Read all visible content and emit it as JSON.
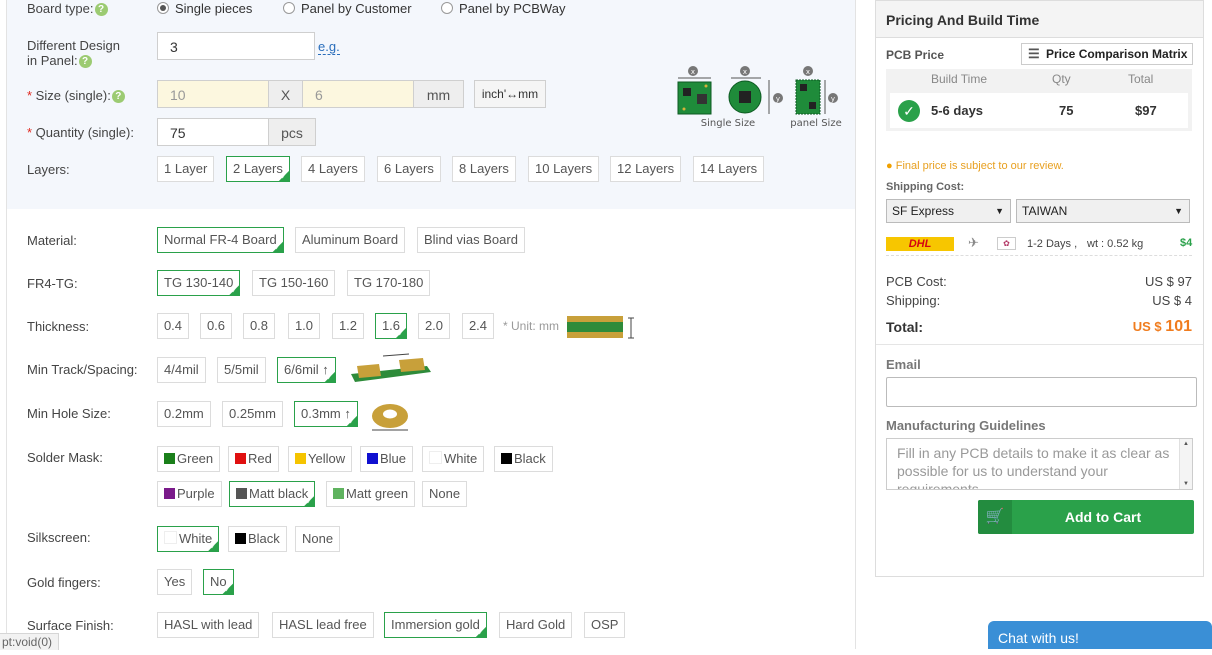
{
  "board_type": {
    "label": "Board type:",
    "options": [
      "Single pieces",
      "Panel by Customer",
      "Panel by PCBWay"
    ],
    "selected": 0
  },
  "diff_design": {
    "label_line1": "Different Design",
    "label_line2": "in Panel:",
    "value": "3",
    "link": "e.g."
  },
  "size": {
    "label": "Size (single):",
    "x_placeholder": "10",
    "sep": "X",
    "y_placeholder": "6",
    "unit": "mm",
    "toggle": "inch'↔mm"
  },
  "quantity": {
    "label": "Quantity (single):",
    "value": "75",
    "unit": "pcs"
  },
  "size_diagram": {
    "single": "Single Size",
    "panel": "panel Size",
    "x": "X",
    "y": "Y"
  },
  "layers": {
    "label": "Layers:",
    "options": [
      "1 Layer",
      "2 Layers",
      "4 Layers",
      "6 Layers",
      "8 Layers",
      "10 Layers",
      "12 Layers",
      "14 Layers"
    ],
    "selected": 1
  },
  "material": {
    "label": "Material:",
    "options": [
      "Normal FR-4 Board",
      "Aluminum Board",
      "Blind vias Board"
    ],
    "selected": 0
  },
  "fr4tg": {
    "label": "FR4-TG:",
    "options": [
      "TG 130-140",
      "TG 150-160",
      "TG 170-180"
    ],
    "selected": 0
  },
  "thickness": {
    "label": "Thickness:",
    "options": [
      "0.4",
      "0.6",
      "0.8",
      "1.0",
      "1.2",
      "1.6",
      "2.0",
      "2.4"
    ],
    "selected": 5,
    "unit": "* Unit: mm"
  },
  "track": {
    "label": "Min Track/Spacing:",
    "options": [
      "4/4mil",
      "5/5mil",
      "6/6mil ↑"
    ],
    "selected": 2
  },
  "hole": {
    "label": "Min Hole Size:",
    "options": [
      "0.2mm",
      "0.25mm",
      "0.3mm ↑"
    ],
    "selected": 2
  },
  "solder": {
    "label": "Solder Mask:",
    "options": [
      {
        "name": "Green",
        "color": "#1a7f1a"
      },
      {
        "name": "Red",
        "color": "#e01010"
      },
      {
        "name": "Yellow",
        "color": "#f5c400"
      },
      {
        "name": "Blue",
        "color": "#1010d0"
      },
      {
        "name": "White",
        "color": "#ffffff"
      },
      {
        "name": "Black",
        "color": "#000000"
      },
      {
        "name": "Purple",
        "color": "#7a1a8a"
      },
      {
        "name": "Matt black",
        "color": "#555555"
      },
      {
        "name": "Matt green",
        "color": "#5fb35f"
      },
      {
        "name": "None",
        "color": ""
      }
    ],
    "selected": 7
  },
  "silkscreen": {
    "label": "Silkscreen:",
    "options": [
      {
        "name": "White",
        "color": "#ffffff"
      },
      {
        "name": "Black",
        "color": "#000000"
      },
      {
        "name": "None",
        "color": ""
      }
    ],
    "selected": 0
  },
  "gold": {
    "label": "Gold fingers:",
    "options": [
      "Yes",
      "No"
    ],
    "selected": 1
  },
  "surface": {
    "label": "Surface Finish:",
    "options": [
      "HASL with lead",
      "HASL lead free",
      "Immersion gold",
      "Hard Gold",
      "OSP"
    ],
    "selected": 2
  },
  "status_bar": "pt:void(0)",
  "side": {
    "title": "Pricing And Build Time",
    "pcb_price": "PCB Price",
    "matrix_btn": "Price Comparison Matrix",
    "cols": [
      "Build Time",
      "Qty",
      "Total"
    ],
    "row": {
      "time": "5-6 days",
      "qty": "75",
      "total": "$97"
    },
    "notice": "Final price is subject to our review.",
    "shipping_label": "Shipping Cost:",
    "carrier": "SF Express",
    "country": "TAIWAN",
    "dhl": "DHL",
    "days": "1-2 Days ,",
    "wt": "wt : 0.52 kg",
    "ship_price": "$4",
    "pcb_cost_label": "PCB Cost:",
    "pcb_cost": "US $ 97",
    "shipping_row_label": "Shipping:",
    "shipping_row": "US $ 4",
    "total_label": "Total:",
    "total_prefix": "US $",
    "total": "101",
    "email_label": "Email",
    "guide_label": "Manufacturing Guidelines",
    "guide_placeholder": "Fill in any PCB details to make it as clear as possible for us to understand your requirements.",
    "cart": "Add to Cart",
    "accent": "#2aa14a",
    "price_color": "#f07c1e"
  },
  "chat": "Chat with us!"
}
